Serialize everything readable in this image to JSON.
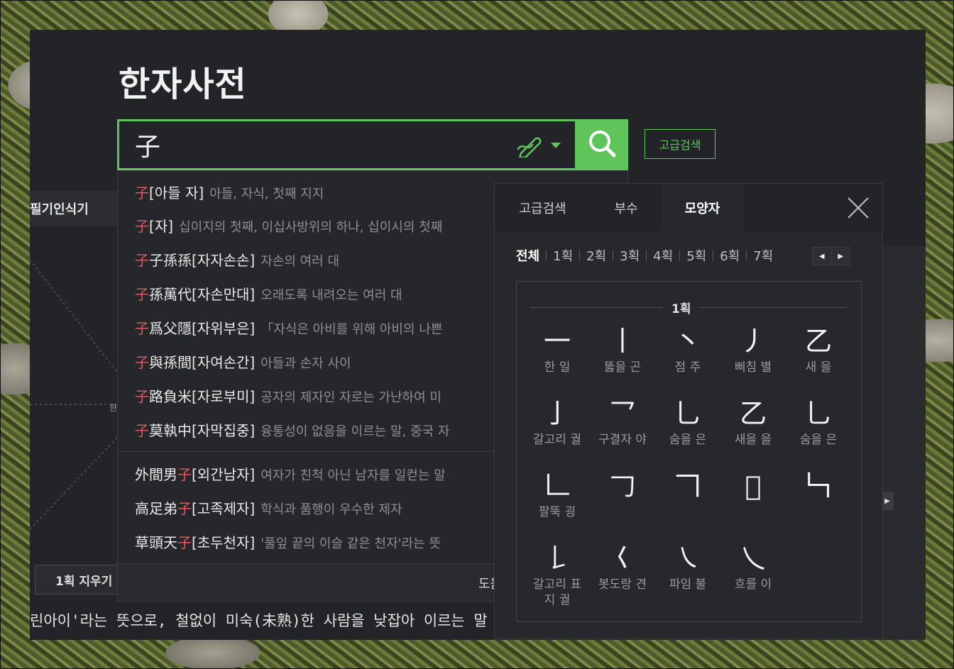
{
  "app": {
    "title": "한자사전"
  },
  "search": {
    "value": "子",
    "advanced_label": "고급검색"
  },
  "background_page": {
    "tab_label": "필기인식기",
    "hint_char": "한",
    "clear_button": "1획 지우기",
    "meaning_line": "린아이'라는 뜻으로, 철없이 미숙(未熟)한 사람을 낮잡아 이르는 말"
  },
  "suggestions": [
    {
      "pre": "",
      "hl": "子",
      "post": "",
      "reading": "[아들  자]",
      "def": "아들, 자식, 첫째 지지"
    },
    {
      "pre": "",
      "hl": "子",
      "post": "",
      "reading": "[자]",
      "def": "십이지의 첫째, 이십사방위의 하나, 십이시의 첫째"
    },
    {
      "pre": "",
      "hl": "子",
      "post": "子孫孫",
      "reading": "[자자손손]",
      "def": "자손의 여러 대"
    },
    {
      "pre": "",
      "hl": "子",
      "post": "孫萬代",
      "reading": "[자손만대]",
      "def": "오래도록 내려오는 여러 대"
    },
    {
      "pre": "",
      "hl": "子",
      "post": "爲父隱",
      "reading": "[자위부은]",
      "def": "「자식은 아비를 위해 아비의 나쁜"
    },
    {
      "pre": "",
      "hl": "子",
      "post": "與孫間",
      "reading": "[자여손간]",
      "def": "아들과 손자 사이"
    },
    {
      "pre": "",
      "hl": "子",
      "post": "路負米",
      "reading": "[자로부미]",
      "def": "공자의 제자인 자로는 가난하여 미"
    },
    {
      "pre": "",
      "hl": "子",
      "post": "莫執中",
      "reading": "[자막집중]",
      "def": "융통성이 없음을 이르는 말, 중국 자"
    },
    {
      "pre": "外間男",
      "hl": "子",
      "post": "",
      "reading": "[외간남자]",
      "def": "여자가 친척 아닌 남자를 일컫는 말"
    },
    {
      "pre": "高足弟",
      "hl": "子",
      "post": "",
      "reading": "[고족제자]",
      "def": "학식과 품행이 우수한 제자"
    },
    {
      "pre": "草頭天",
      "hl": "子",
      "post": "",
      "reading": "[초두천자]",
      "def": "'풀잎 끝의 이슬 같은 천자'라는 뜻"
    }
  ],
  "suggest_footer": {
    "label": "도움"
  },
  "advanced_panel": {
    "tabs": [
      "고급검색",
      "부수",
      "모양자"
    ],
    "active_tab": "모양자",
    "stroke_filters": [
      "전체",
      "1획",
      "2획",
      "3획",
      "4획",
      "5획",
      "6획",
      "7획"
    ],
    "active_filter": "전체",
    "pager": {
      "prev": "◀",
      "next": "▶"
    },
    "group_label": "1획",
    "glyphs": [
      {
        "char": "一",
        "name": "한 일"
      },
      {
        "char": "丨",
        "name": "뚫을 곤"
      },
      {
        "char": "丶",
        "name": "점 주"
      },
      {
        "char": "丿",
        "name": "삐침 별"
      },
      {
        "char": "乙",
        "name": "새 을"
      },
      {
        "char": "亅",
        "name": "갈고리 궐"
      },
      {
        "char": "乛",
        "name": "구결자 야"
      },
      {
        "char": "乚",
        "name": "숨을 은"
      },
      {
        "char": "乙",
        "name": "새을 을"
      },
      {
        "char": "乚",
        "name": "숨을 은"
      },
      {
        "char": "𠃊",
        "name": "팔뚝 굉"
      },
      {
        "char": "𠃌",
        "name": ""
      },
      {
        "char": "𠃍",
        "name": ""
      },
      {
        "char": "𠃎",
        "name": ""
      },
      {
        "char": "𠃑",
        "name": ""
      },
      {
        "char": "𠄌",
        "name": "갈고리 표 지 궐"
      },
      {
        "char": "𡿨",
        "name": "봇도랑 견"
      },
      {
        "char": "㇏",
        "name": "파임 불"
      },
      {
        "char": "乀",
        "name": "흐를 이"
      }
    ]
  },
  "colors": {
    "accent": "#5fc55b",
    "highlight": "#e05a5a",
    "panel_bg": "#232427"
  }
}
